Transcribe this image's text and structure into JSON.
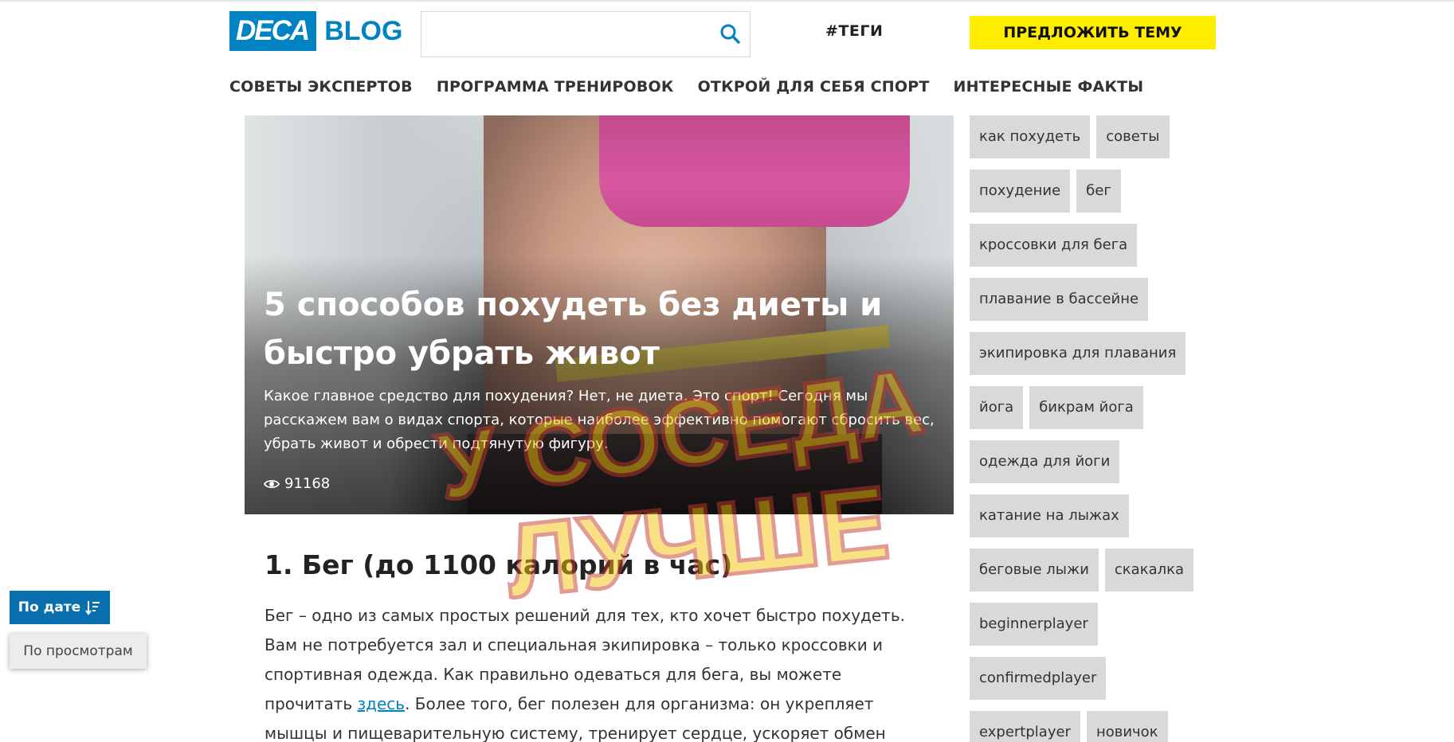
{
  "header": {
    "logo_main": "DECA",
    "logo_sub": "BLOG",
    "search_placeholder": "",
    "tags_link": "#ТЕГИ",
    "suggest_button": "ПРЕДЛОЖИТЬ ТЕМУ"
  },
  "nav": {
    "items": [
      "СОВЕТЫ ЭКСПЕРТОВ",
      "ПРОГРАММА ТРЕНИРОВОК",
      "ОТКРОЙ ДЛЯ СЕБЯ СПОРТ",
      "ИНТЕРЕСНЫЕ ФАКТЫ"
    ]
  },
  "hero": {
    "title": "5 способов похудеть без диеты и быстро убрать живот",
    "description": "Какое главное средство для похудения? Нет, не диета. Это спорт! Сегодня мы расскажем вам о видах спорта, которые наиболее эффективно помогают сбросить вес, убрать живот и обрести подтянутую фигуру.",
    "views": "91168"
  },
  "article": {
    "heading": "1. Бег (до 1100 калорий в час)",
    "paragraph_before_link": "Бег – одно из самых простых решений для тех, кто хочет быстро похудеть. Вам не потребуется зал и специальная экипировка – только кроссовки и спортивная одежда. Как правильно одеваться для бега, вы можете прочитать ",
    "link_text": "здесь",
    "paragraph_after_link": ". Более того, бег полезен для организма: он укрепляет мышцы и пищеварительную систему, тренирует сердце, ускоряет обмен веществ и"
  },
  "tags": [
    "как похудеть",
    "советы",
    "похудение",
    "бег",
    "кроссовки для бега",
    "плавание в бассейне",
    "экипировка для плавания",
    "йога",
    "бикрам йога",
    "одежда для йоги",
    "катание на лыжах",
    "беговые лыжи",
    "скакалка",
    "beginnerplayer",
    "confirmedplayer",
    "expertplayer",
    "новичок"
  ],
  "sort": {
    "by_date": "По дате",
    "by_views": "По просмотрам"
  },
  "watermark": {
    "line1": "У СОСЕДА",
    "line2": "ЛУЧШЕ"
  },
  "colors": {
    "brand_blue": "#0082c3",
    "accent_yellow": "#ffed00",
    "tag_bg": "#d9d9d9",
    "sort_active_bg": "#0a6fae"
  },
  "icons": {
    "search": "search-icon",
    "views": "eye-icon",
    "sort": "sort-descending-icon"
  }
}
